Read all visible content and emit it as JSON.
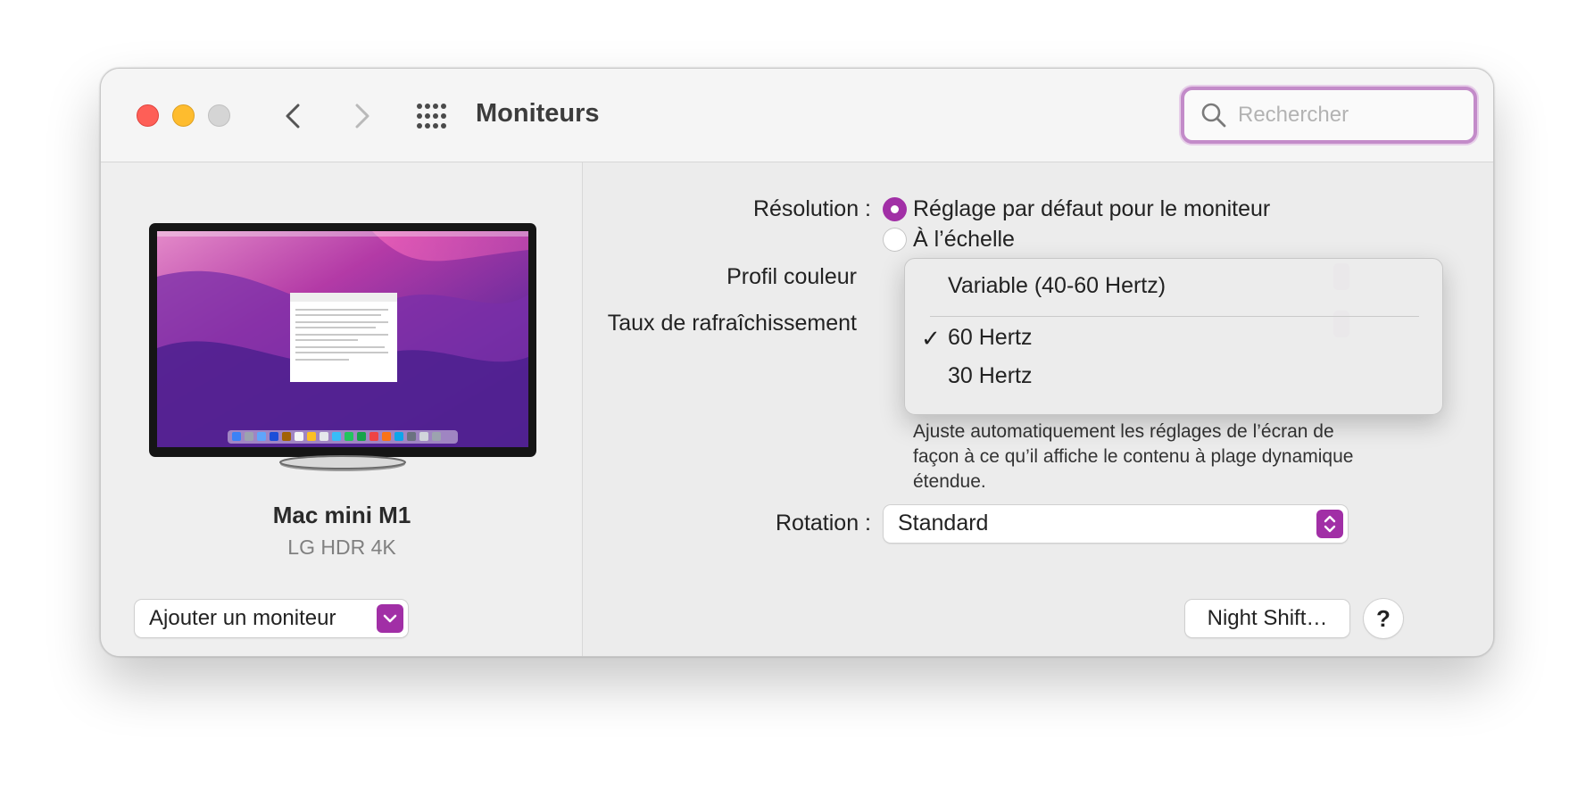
{
  "window": {
    "title": "Moniteurs",
    "search": {
      "placeholder": "Rechercher",
      "value": ""
    }
  },
  "sidebar": {
    "device_name": "Mac mini M1",
    "device_model": "LG HDR 4K",
    "add_monitor_label": "Ajouter un moniteur"
  },
  "settings": {
    "resolution_label": "Résolution :",
    "resolution_options": [
      {
        "label": "Réglage par défaut pour le moniteur",
        "selected": true
      },
      {
        "label": "À l’échelle",
        "selected": false
      }
    ],
    "color_profile_label": "Profil couleur",
    "refresh_rate_label": "Taux de rafraîchissement",
    "hdr_description": "Ajuste automatiquement les réglages de l’écran de façon à ce qu’il affiche le contenu à plage dynamique étendue.",
    "rotation_label": "Rotation :",
    "rotation_value": "Standard",
    "night_shift_label": "Night Shift…",
    "help_label": "?"
  },
  "refresh_menu": {
    "items": [
      {
        "label": "Variable (40-60 Hertz)",
        "checked": false
      },
      {
        "label": "60 Hertz",
        "checked": true
      },
      {
        "label": "30 Hertz",
        "checked": false
      }
    ],
    "check_glyph": "✓"
  },
  "colors": {
    "accent": "#a12fa6",
    "search_focus": "#c38bc9",
    "close": "#fe5f57",
    "minimize": "#febc2e",
    "zoom": "#d5d5d5"
  },
  "icons": {
    "back": "chevron-left-icon",
    "forward": "chevron-right-icon",
    "all_prefs": "grid-icon",
    "search": "magnifier-icon",
    "popup": "chevron-down-icon",
    "stepper": "up-down-chevron-icon"
  }
}
